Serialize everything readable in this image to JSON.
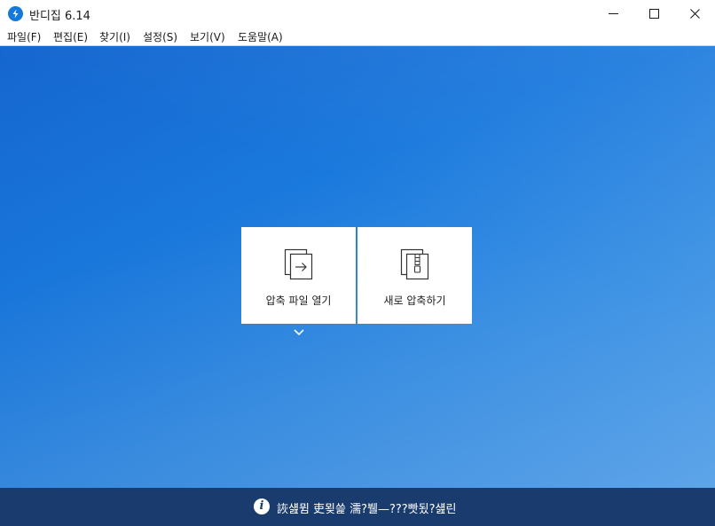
{
  "window": {
    "title": "반디집 6.14",
    "accent": "#1479d9"
  },
  "menu": [
    {
      "label": "파일(F)"
    },
    {
      "label": "편집(E)"
    },
    {
      "label": "찾기(I)"
    },
    {
      "label": "설정(S)"
    },
    {
      "label": "보기(V)"
    },
    {
      "label": "도움말(A)"
    }
  ],
  "main": {
    "open_card_label": "압축 파일 열기",
    "new_card_label": "새로 압축하기",
    "background": "#1a79dd"
  },
  "status": {
    "text": "詼섎뮘 吏묒쓽 濡?뷀—???빳됬?섎린",
    "background": "#1a3b6e"
  }
}
